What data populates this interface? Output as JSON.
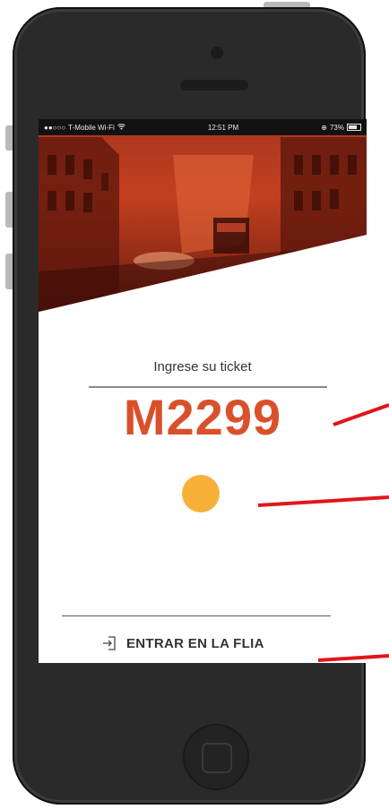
{
  "status_bar": {
    "carrier": "T-Mobile Wi-Fi",
    "time": "12:51 PM",
    "battery": "73%"
  },
  "login": {
    "prompt": "Ingrese su ticket",
    "ticket_value": "M2299",
    "enter_label": "ENTRAR EN LA FLIA"
  },
  "colors": {
    "accent": "#d9502b",
    "dot": "#f7b13a",
    "annotation": "#e1161b"
  },
  "icons": {
    "enter": "login-arrow-icon",
    "wifi": "wifi-icon",
    "battery": "battery-icon"
  }
}
